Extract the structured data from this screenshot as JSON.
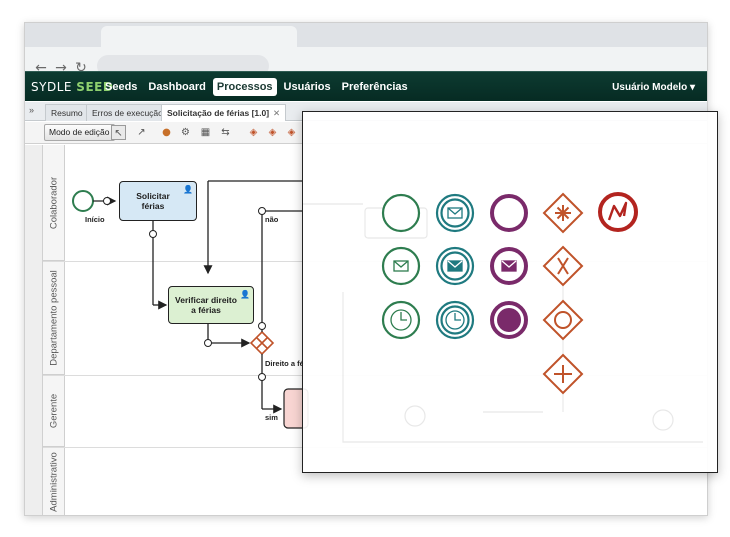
{
  "browser": {
    "back_icon": "arrow-left-icon",
    "forward_icon": "arrow-right-icon",
    "reload_icon": "reload-icon"
  },
  "app": {
    "logo_left": "SYDLE",
    "logo_right": "SEED",
    "menu": [
      {
        "label": "Seeds",
        "active": false
      },
      {
        "label": "Dashboard",
        "active": false
      },
      {
        "label": "Processos",
        "active": true
      },
      {
        "label": "Usuários",
        "active": false
      },
      {
        "label": "Preferências",
        "active": false
      }
    ],
    "user_label": "Usuário Modelo",
    "user_caret": "▾"
  },
  "tabs": {
    "collapse": "»",
    "items": [
      {
        "label": "Resumo"
      },
      {
        "label": "Erros de execução"
      },
      {
        "label": "Solicitação de férias [1.0]",
        "close": "✕"
      }
    ]
  },
  "toolbar": {
    "edit_mode_label": "Modo de edição"
  },
  "lanes": [
    {
      "label": "Colaborador"
    },
    {
      "label": "Departamento pessoal"
    },
    {
      "label": "Gerente"
    },
    {
      "label": "Administrativo"
    }
  ],
  "diagram": {
    "start_label": "Início",
    "task1": "Solicitar férias",
    "task2": "Verificar direito a férias",
    "gateway_label": "Direito a fé",
    "flow_no": "não",
    "flow_yes": "sim"
  },
  "palette": {
    "elements": [
      {
        "name": "start-event-icon",
        "color": "#2e7d4f"
      },
      {
        "name": "message-intermediate-event-icon",
        "color": "#1f7a80"
      },
      {
        "name": "intermediate-event-icon",
        "color": "#7a2a6a"
      },
      {
        "name": "complex-gateway-icon",
        "color": "#c0532a"
      },
      {
        "name": "error-end-event-icon",
        "color": "#b3241f"
      },
      {
        "name": "message-start-event-icon",
        "color": "#2e7d4f"
      },
      {
        "name": "message-catch-event-icon",
        "color": "#1f7a80"
      },
      {
        "name": "message-end-event-icon",
        "color": "#7a2a6a"
      },
      {
        "name": "exclusive-gateway-icon",
        "color": "#c0532a"
      },
      {
        "name": "timer-start-event-icon",
        "color": "#2e7d4f"
      },
      {
        "name": "timer-intermediate-event-icon",
        "color": "#1f7a80"
      },
      {
        "name": "end-event-icon",
        "color": "#7a2a6a"
      },
      {
        "name": "inclusive-gateway-icon",
        "color": "#c0532a"
      },
      {
        "name": "parallel-gateway-icon",
        "color": "#c0532a"
      }
    ]
  }
}
